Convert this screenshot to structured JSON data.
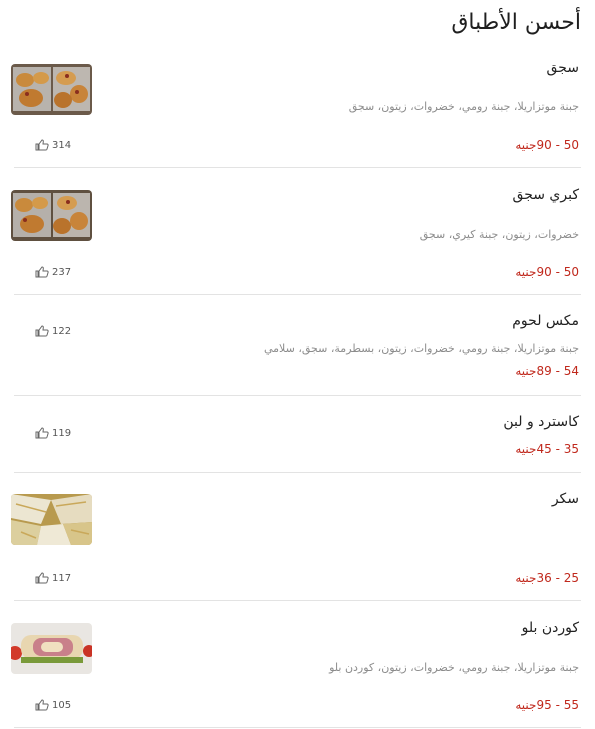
{
  "section": {
    "title": "أحسن الأطباق"
  },
  "items": [
    {
      "name": "سجق",
      "desc": "جبنة موتزاريلا، جبنة رومي، خضروات، زيتون، سجق",
      "price": "50 - 90جنيه",
      "likes": "314",
      "image": "sausage-pizza-tray"
    },
    {
      "name": "كبري سجق",
      "desc": "خضروات، زيتون، جبنة كيري، سجق",
      "price": "50 - 90جنيه",
      "likes": "237",
      "image": "sausage-pizza-tray"
    },
    {
      "name": "مكس لحوم",
      "desc": "جبنة موتزاريلا، جبنة رومي، خضروات، زيتون، بسطرمة، سجق، سلامي",
      "price": "54 - 89جنيه",
      "likes": "122"
    },
    {
      "name": "كاسترد و لبن",
      "desc": "",
      "price": "35 - 45جنيه",
      "likes": "119"
    },
    {
      "name": "سكر",
      "desc": "",
      "price": "25 - 36جنيه",
      "likes": "117",
      "image": "sugar-feteer"
    },
    {
      "name": "كوردن بلو",
      "desc": "جبنة موتزاريلا، جبنة رومي، خضروات، زيتون، كوردن بلو",
      "price": "55 - 95جنيه",
      "likes": "105",
      "image": "cordon-bleu-roll"
    }
  ]
}
